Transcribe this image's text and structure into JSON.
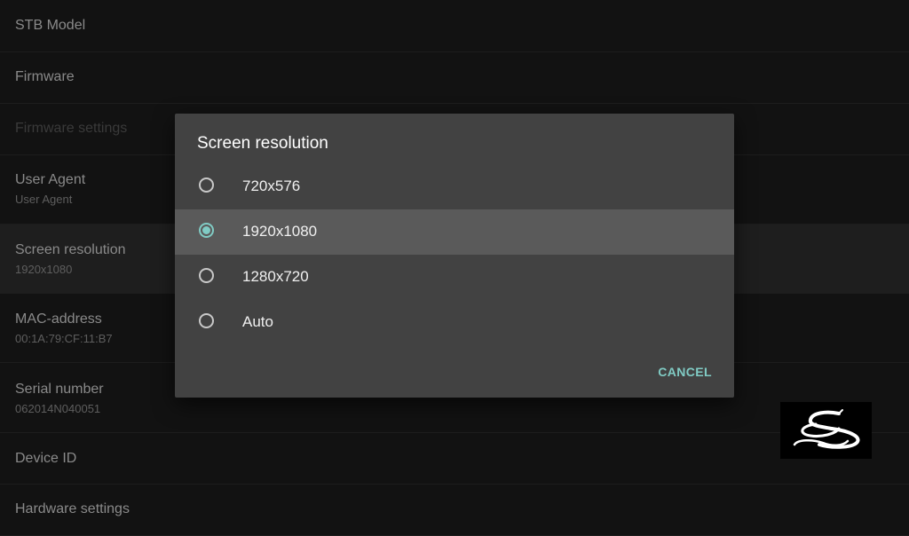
{
  "settings": {
    "items": [
      {
        "title": "STB Model",
        "summary": null
      },
      {
        "title": "Firmware",
        "summary": null
      },
      {
        "title": "Firmware settings",
        "summary": null,
        "disabled": true
      },
      {
        "title": "User Agent",
        "summary": "User Agent"
      },
      {
        "title": "Screen resolution",
        "summary": "1920x1080",
        "focused": true
      },
      {
        "title": "MAC-address",
        "summary": "00:1A:79:CF:11:B7"
      },
      {
        "title": "Serial number",
        "summary": "062014N040051"
      },
      {
        "title": "Device ID",
        "summary": null
      },
      {
        "title": "Hardware settings",
        "summary": null
      }
    ]
  },
  "dialog": {
    "title": "Screen resolution",
    "options": [
      {
        "label": "720x576",
        "selected": false
      },
      {
        "label": "1920x1080",
        "selected": true
      },
      {
        "label": "1280x720",
        "selected": false
      },
      {
        "label": "Auto",
        "selected": false
      }
    ],
    "cancel_label": "CANCEL"
  },
  "colors": {
    "accent": "#80cbc4",
    "dialog_bg": "#424242",
    "selected_bg": "#5a5a5a",
    "background": "#121212"
  },
  "logo": {
    "icon": "stylized-s-logo-icon"
  }
}
